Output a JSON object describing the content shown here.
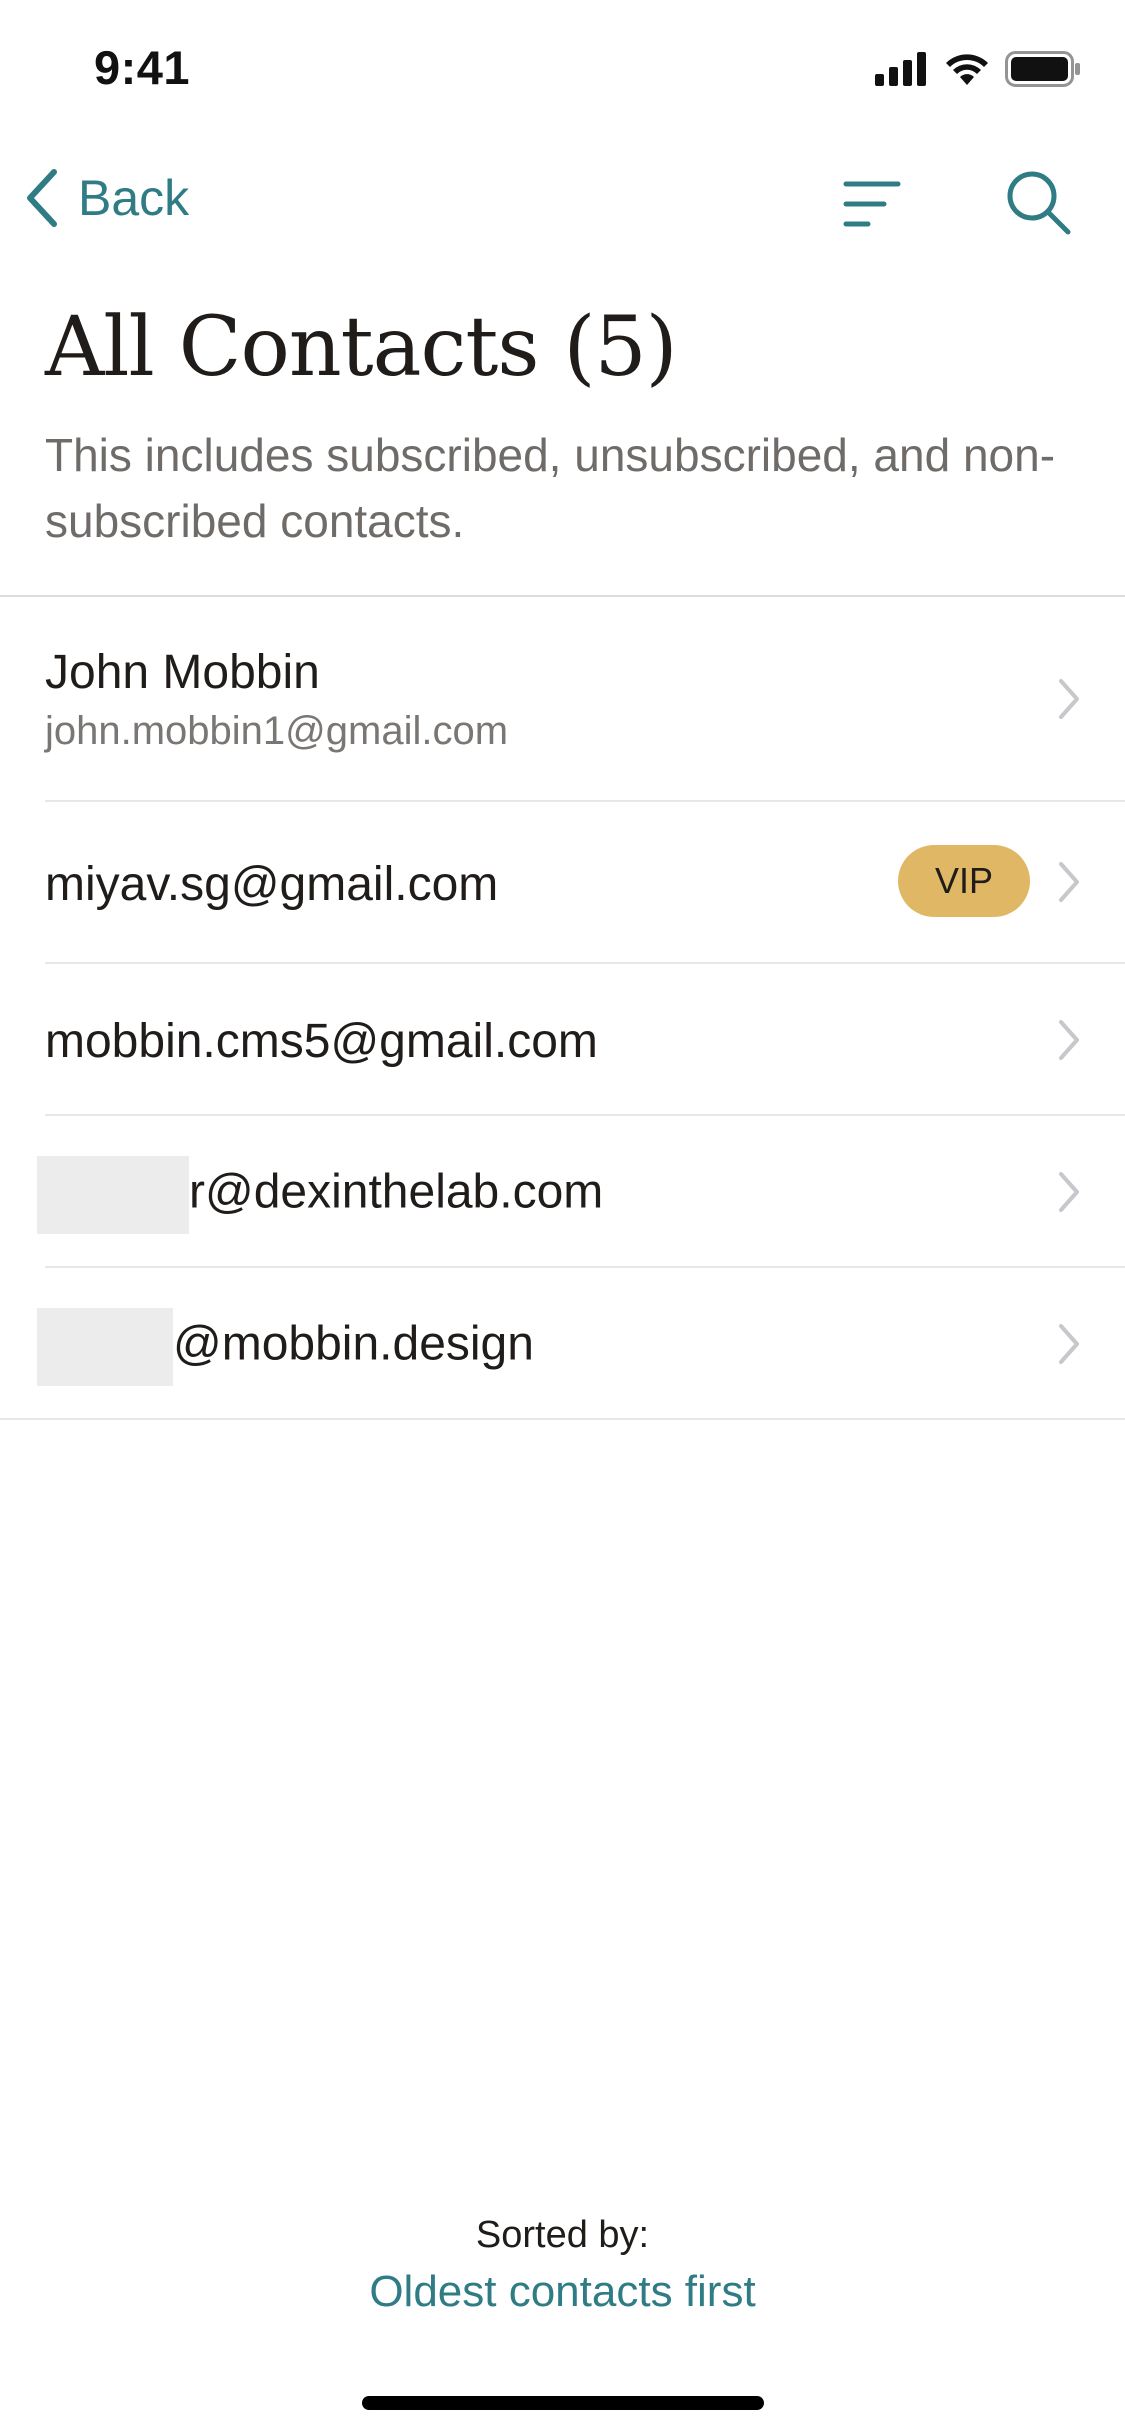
{
  "status_bar": {
    "time": "9:41"
  },
  "nav": {
    "back_label": "Back"
  },
  "header": {
    "title": "All Contacts (5)",
    "subtitle": "This includes subscribed, unsubscribed, and non-subscribed contacts."
  },
  "contacts": [
    {
      "name": "John Mobbin",
      "email": "john.mobbin1@gmail.com"
    },
    {
      "email": "miyav.sg@gmail.com",
      "badge": "VIP"
    },
    {
      "email": "mobbin.cms5@gmail.com"
    },
    {
      "email_visible": "r@dexinthelab.com"
    },
    {
      "email_visible": "@mobbin.design"
    }
  ],
  "footer": {
    "sorted_label": "Sorted by:",
    "sorted_value": "Oldest contacts first"
  },
  "colors": {
    "accent": "#2f7c85",
    "vip_badge": "#e0b865",
    "text_primary": "#1f1c1a",
    "text_secondary": "#6f6b68",
    "chevron": "#c7c7cc",
    "separator": "#e7e7e7"
  },
  "icons": [
    "cellular-signal-icon",
    "wifi-icon",
    "battery-icon",
    "chevron-left-icon",
    "filter-icon",
    "search-icon",
    "chevron-right-icon"
  ]
}
